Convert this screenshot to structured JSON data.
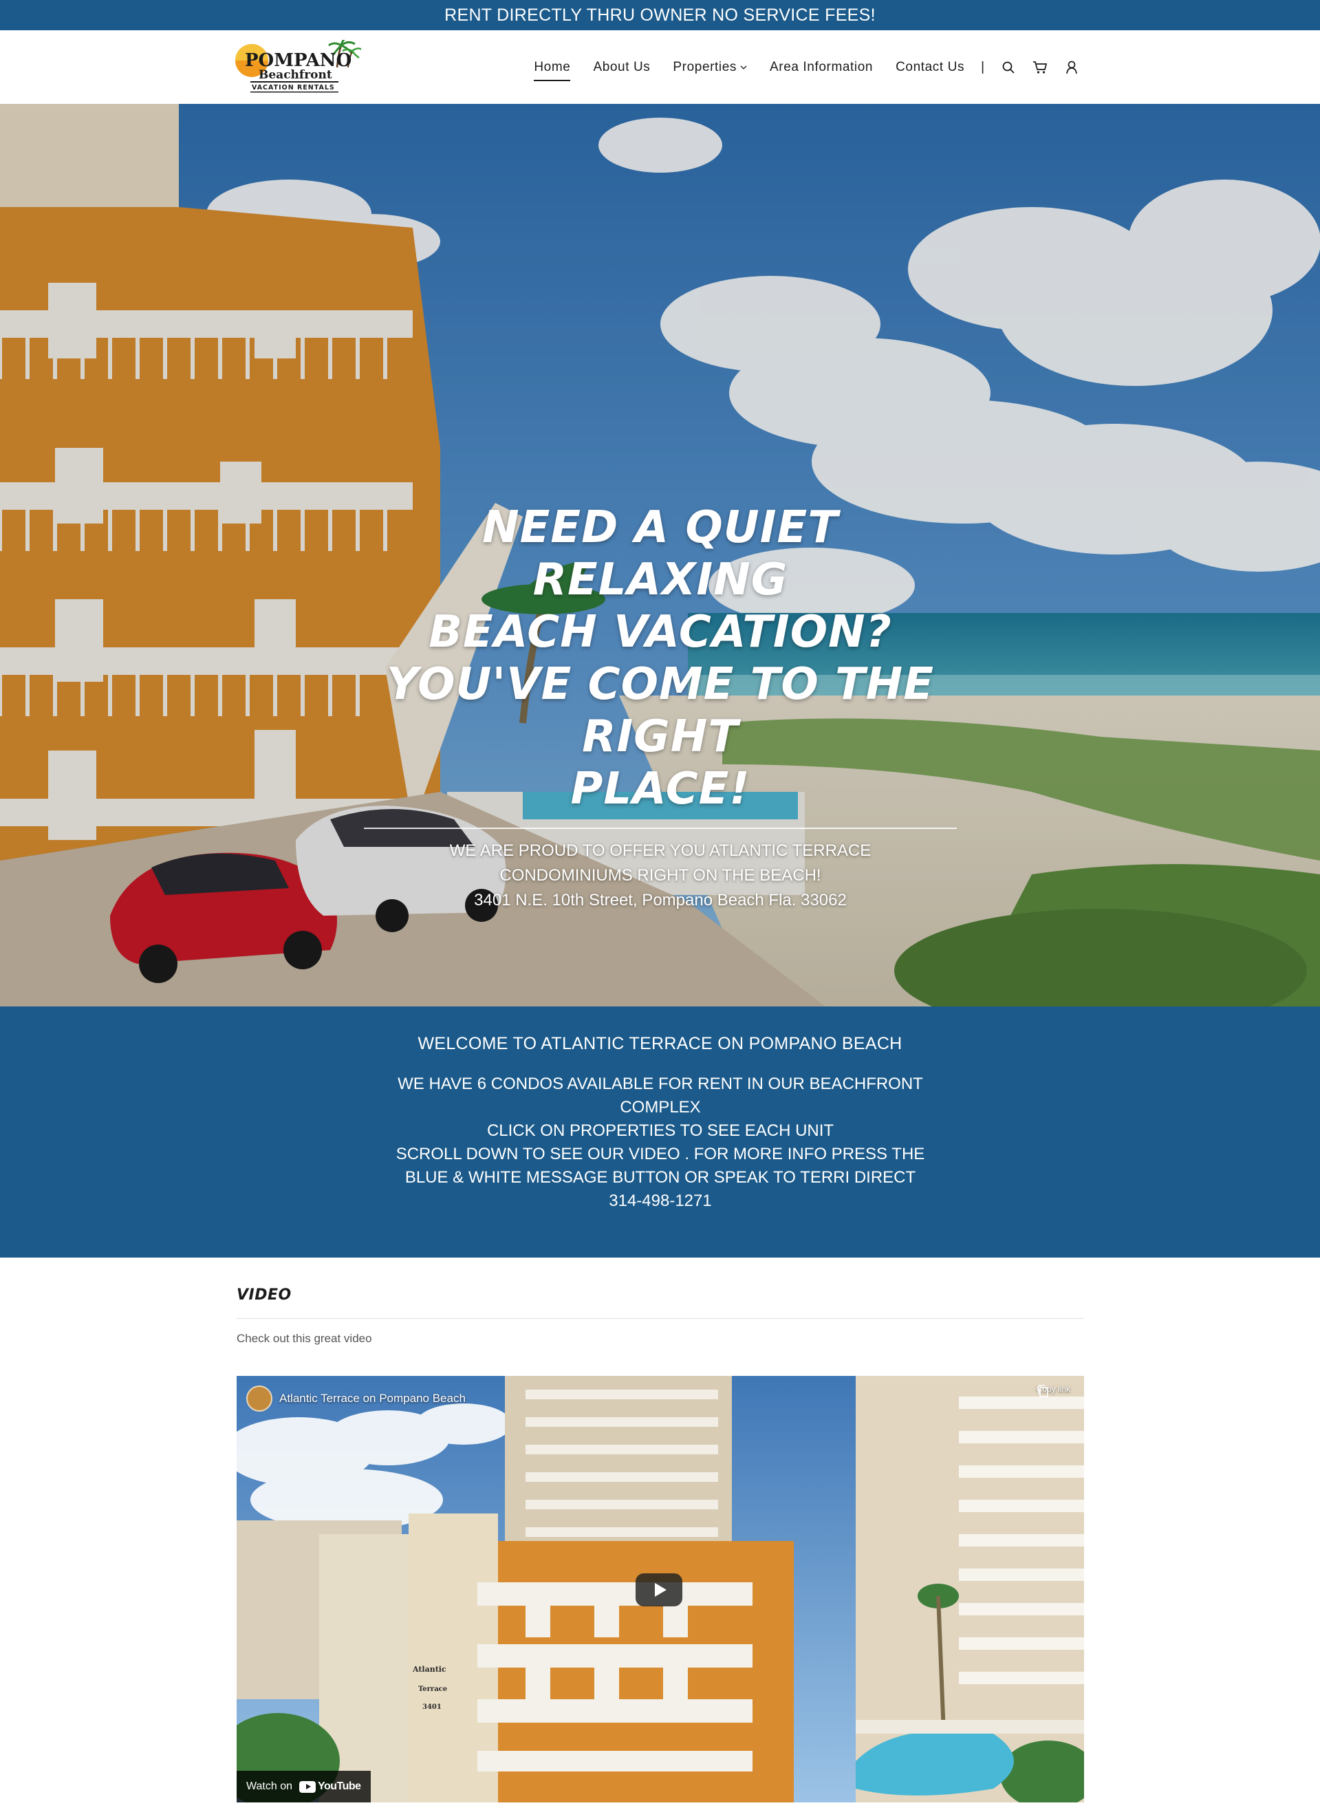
{
  "announcement": {
    "text": "RENT DIRECTLY THRU OWNER NO SERVICE FEES!"
  },
  "brand": {
    "logo_line1": "POMPANO",
    "logo_line2": "Beachfront",
    "logo_line3": "VACATION RENTALS"
  },
  "nav": {
    "items": [
      {
        "label": "Home",
        "active": true
      },
      {
        "label": "About Us",
        "active": false
      },
      {
        "label": "Properties",
        "active": false,
        "has_dropdown": true
      },
      {
        "label": "Area Information",
        "active": false
      },
      {
        "label": "Contact Us",
        "active": false
      }
    ],
    "separator": "|",
    "icons": [
      "search-icon",
      "cart-icon",
      "account-icon"
    ]
  },
  "hero": {
    "title_line1": "NEED A QUIET RELAXING",
    "title_line2": "BEACH VACATION?",
    "title_line3": "YOU'VE COME TO THE RIGHT",
    "title_line4": "PLACE!",
    "sub_line1": "WE ARE PROUD TO OFFER YOU ATLANTIC TERRACE",
    "sub_line2": "CONDOMINIUMS RIGHT ON THE BEACH!",
    "sub_line3": "3401 N.E. 10th Street, Pompano Beach Fla. 33062"
  },
  "welcome": {
    "title": "WELCOME TO ATLANTIC TERRACE ON POMPANO BEACH",
    "line1": "WE HAVE 6 CONDOS AVAILABLE FOR RENT IN OUR BEACHFRONT COMPLEX",
    "line2": "CLICK ON PROPERTIES TO SEE EACH UNIT",
    "line3": "SCROLL DOWN TO SEE OUR VIDEO .  FOR MORE INFO PRESS THE BLUE & WHITE MESSAGE BUTTON OR SPEAK TO TERRI DIRECT 314-498-1271"
  },
  "video": {
    "heading": "VIDEO",
    "subtitle": "Check out this great video",
    "embed_title": "Atlantic Terrace on Pompano Beach",
    "copy_link_label": "Copy link",
    "watch_on_label": "Watch on",
    "youtube_label": "YouTube",
    "building_sign": "Atlantic Terrace 3401"
  },
  "colors": {
    "brand_blue": "#1b5a8a",
    "white": "#ffffff",
    "text_dark": "#1b1b1b"
  }
}
